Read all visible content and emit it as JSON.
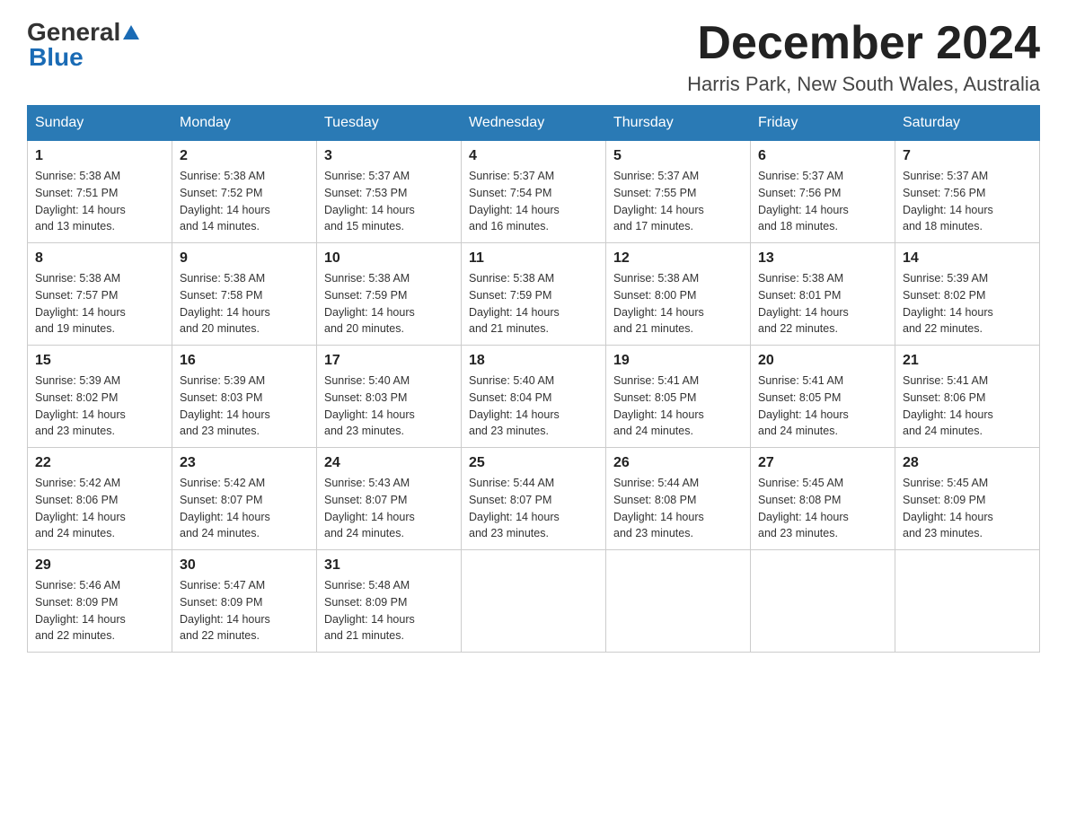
{
  "header": {
    "logo_general": "General",
    "logo_blue": "Blue",
    "month_title": "December 2024",
    "location": "Harris Park, New South Wales, Australia"
  },
  "columns": [
    "Sunday",
    "Monday",
    "Tuesday",
    "Wednesday",
    "Thursday",
    "Friday",
    "Saturday"
  ],
  "weeks": [
    [
      {
        "day": "1",
        "sunrise": "5:38 AM",
        "sunset": "7:51 PM",
        "daylight": "14 hours and 13 minutes."
      },
      {
        "day": "2",
        "sunrise": "5:38 AM",
        "sunset": "7:52 PM",
        "daylight": "14 hours and 14 minutes."
      },
      {
        "day": "3",
        "sunrise": "5:37 AM",
        "sunset": "7:53 PM",
        "daylight": "14 hours and 15 minutes."
      },
      {
        "day": "4",
        "sunrise": "5:37 AM",
        "sunset": "7:54 PM",
        "daylight": "14 hours and 16 minutes."
      },
      {
        "day": "5",
        "sunrise": "5:37 AM",
        "sunset": "7:55 PM",
        "daylight": "14 hours and 17 minutes."
      },
      {
        "day": "6",
        "sunrise": "5:37 AM",
        "sunset": "7:56 PM",
        "daylight": "14 hours and 18 minutes."
      },
      {
        "day": "7",
        "sunrise": "5:37 AM",
        "sunset": "7:56 PM",
        "daylight": "14 hours and 18 minutes."
      }
    ],
    [
      {
        "day": "8",
        "sunrise": "5:38 AM",
        "sunset": "7:57 PM",
        "daylight": "14 hours and 19 minutes."
      },
      {
        "day": "9",
        "sunrise": "5:38 AM",
        "sunset": "7:58 PM",
        "daylight": "14 hours and 20 minutes."
      },
      {
        "day": "10",
        "sunrise": "5:38 AM",
        "sunset": "7:59 PM",
        "daylight": "14 hours and 20 minutes."
      },
      {
        "day": "11",
        "sunrise": "5:38 AM",
        "sunset": "7:59 PM",
        "daylight": "14 hours and 21 minutes."
      },
      {
        "day": "12",
        "sunrise": "5:38 AM",
        "sunset": "8:00 PM",
        "daylight": "14 hours and 21 minutes."
      },
      {
        "day": "13",
        "sunrise": "5:38 AM",
        "sunset": "8:01 PM",
        "daylight": "14 hours and 22 minutes."
      },
      {
        "day": "14",
        "sunrise": "5:39 AM",
        "sunset": "8:02 PM",
        "daylight": "14 hours and 22 minutes."
      }
    ],
    [
      {
        "day": "15",
        "sunrise": "5:39 AM",
        "sunset": "8:02 PM",
        "daylight": "14 hours and 23 minutes."
      },
      {
        "day": "16",
        "sunrise": "5:39 AM",
        "sunset": "8:03 PM",
        "daylight": "14 hours and 23 minutes."
      },
      {
        "day": "17",
        "sunrise": "5:40 AM",
        "sunset": "8:03 PM",
        "daylight": "14 hours and 23 minutes."
      },
      {
        "day": "18",
        "sunrise": "5:40 AM",
        "sunset": "8:04 PM",
        "daylight": "14 hours and 23 minutes."
      },
      {
        "day": "19",
        "sunrise": "5:41 AM",
        "sunset": "8:05 PM",
        "daylight": "14 hours and 24 minutes."
      },
      {
        "day": "20",
        "sunrise": "5:41 AM",
        "sunset": "8:05 PM",
        "daylight": "14 hours and 24 minutes."
      },
      {
        "day": "21",
        "sunrise": "5:41 AM",
        "sunset": "8:06 PM",
        "daylight": "14 hours and 24 minutes."
      }
    ],
    [
      {
        "day": "22",
        "sunrise": "5:42 AM",
        "sunset": "8:06 PM",
        "daylight": "14 hours and 24 minutes."
      },
      {
        "day": "23",
        "sunrise": "5:42 AM",
        "sunset": "8:07 PM",
        "daylight": "14 hours and 24 minutes."
      },
      {
        "day": "24",
        "sunrise": "5:43 AM",
        "sunset": "8:07 PM",
        "daylight": "14 hours and 24 minutes."
      },
      {
        "day": "25",
        "sunrise": "5:44 AM",
        "sunset": "8:07 PM",
        "daylight": "14 hours and 23 minutes."
      },
      {
        "day": "26",
        "sunrise": "5:44 AM",
        "sunset": "8:08 PM",
        "daylight": "14 hours and 23 minutes."
      },
      {
        "day": "27",
        "sunrise": "5:45 AM",
        "sunset": "8:08 PM",
        "daylight": "14 hours and 23 minutes."
      },
      {
        "day": "28",
        "sunrise": "5:45 AM",
        "sunset": "8:09 PM",
        "daylight": "14 hours and 23 minutes."
      }
    ],
    [
      {
        "day": "29",
        "sunrise": "5:46 AM",
        "sunset": "8:09 PM",
        "daylight": "14 hours and 22 minutes."
      },
      {
        "day": "30",
        "sunrise": "5:47 AM",
        "sunset": "8:09 PM",
        "daylight": "14 hours and 22 minutes."
      },
      {
        "day": "31",
        "sunrise": "5:48 AM",
        "sunset": "8:09 PM",
        "daylight": "14 hours and 21 minutes."
      },
      null,
      null,
      null,
      null
    ]
  ],
  "labels": {
    "sunrise": "Sunrise:",
    "sunset": "Sunset:",
    "daylight": "Daylight:"
  }
}
